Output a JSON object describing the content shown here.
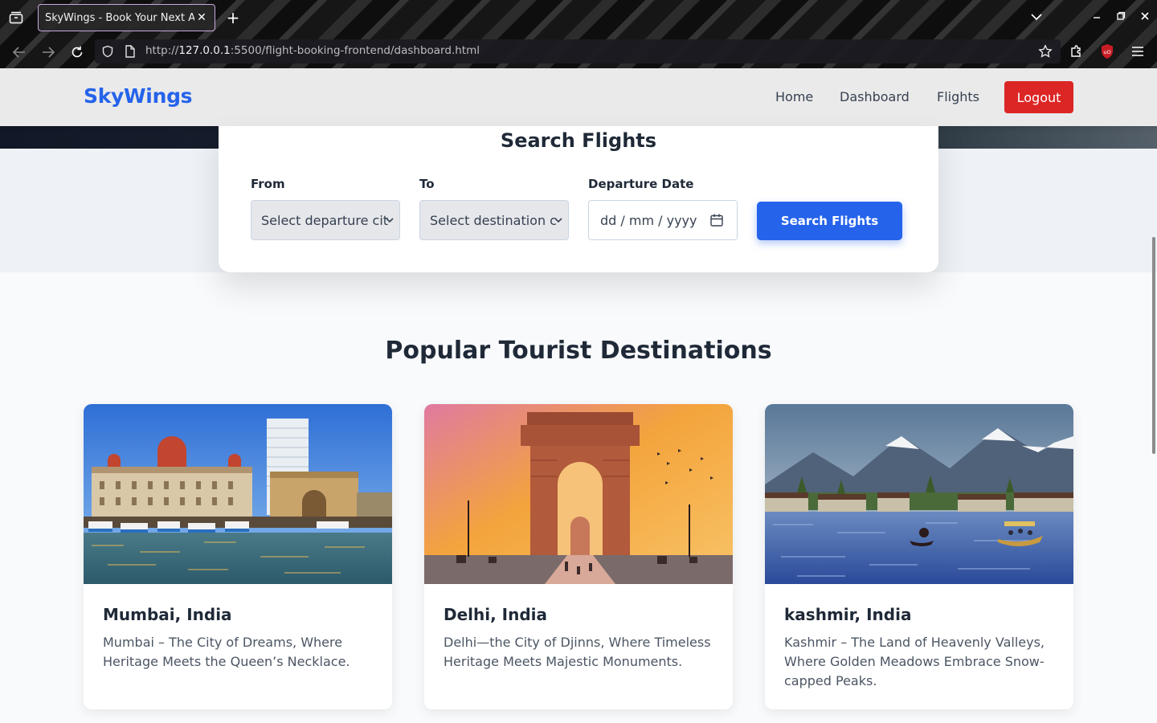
{
  "browser": {
    "tab_title": "SkyWings - Book Your Next Adv",
    "url_prefix": "http://",
    "url_host": "127.0.0.1",
    "url_rest": ":5500/flight-booking-frontend/dashboard.html"
  },
  "header": {
    "brand": "SkyWings",
    "nav": [
      "Home",
      "Dashboard",
      "Flights"
    ],
    "logout_label": "Logout"
  },
  "search": {
    "title": "Search Flights",
    "from_label": "From",
    "from_value": "Select departure cit",
    "to_label": "To",
    "to_value": "Select destination c",
    "date_label": "Departure Date",
    "date_placeholder": "dd / mm / yyyy",
    "button_label": "Search Flights"
  },
  "destinations": {
    "title": "Popular Tourist Destinations",
    "items": [
      {
        "name": "Mumbai, India",
        "description": "Mumbai – The City of Dreams, Where Heritage Meets the Queen’s Necklace."
      },
      {
        "name": "Delhi, India",
        "description": "Delhi—the City of Djinns, Where Timeless Heritage Meets Majestic Monuments."
      },
      {
        "name": "kashmir, India",
        "description": "Kashmir – The Land of Heavenly Valleys, Where Golden Meadows Embrace Snow-capped Peaks."
      }
    ]
  },
  "colors": {
    "brand": "#2563eb",
    "logout": "#dc2626",
    "primary_button": "#2563eb"
  }
}
